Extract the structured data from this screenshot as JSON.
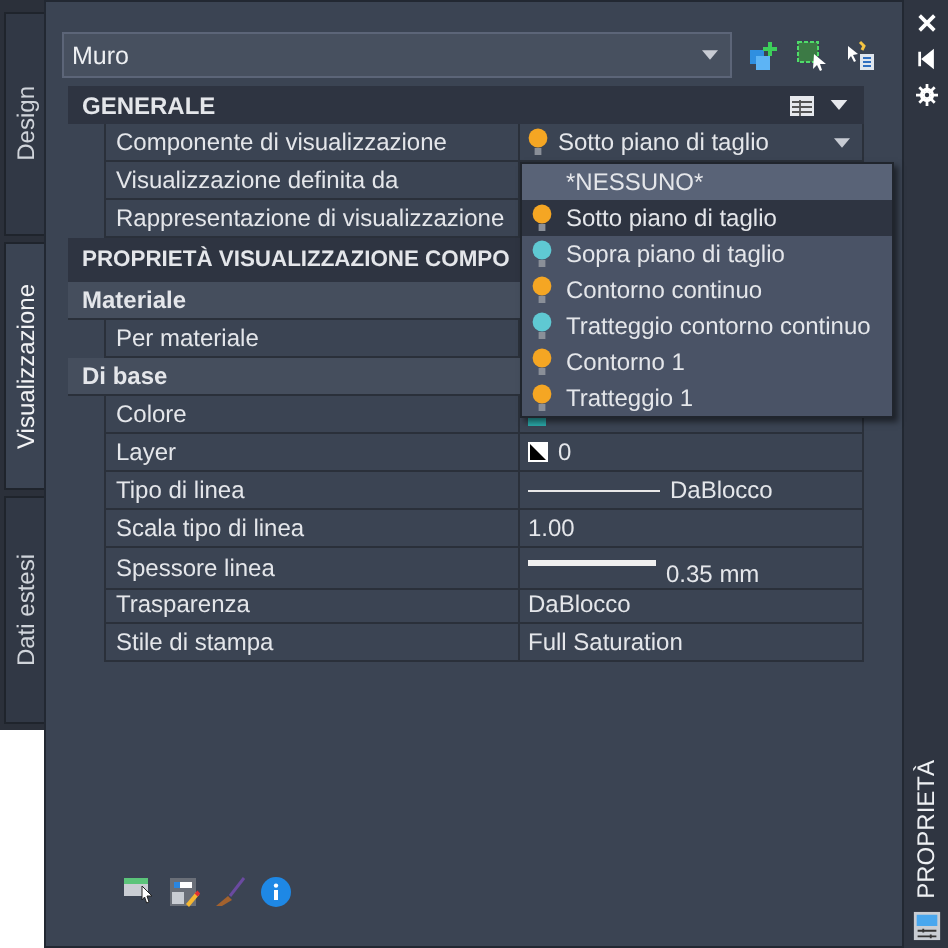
{
  "tabs": [
    {
      "label": "Design",
      "selected": false
    },
    {
      "label": "Visualizzazione",
      "selected": true
    },
    {
      "label": "Dati estesi",
      "selected": false
    }
  ],
  "object_selector": {
    "value": "Muro"
  },
  "grid": [
    {
      "kind": "section",
      "label": "GENERALE",
      "tools": true
    },
    {
      "kind": "bulb",
      "label": "Componente di visualizzazione",
      "value": "Sotto piano di taglio",
      "color": "#f5a623",
      "dropdown": true
    },
    {
      "kind": "property",
      "label": "Visualizzazione definita da"
    },
    {
      "kind": "property",
      "label": "Rappresentazione di visualizzazione"
    },
    {
      "kind": "section",
      "label": "PROPRIETÀ VISUALIZZAZIONE COMPO"
    },
    {
      "kind": "category",
      "label": "Materiale"
    },
    {
      "kind": "property",
      "label": "Per materiale"
    },
    {
      "kind": "category",
      "label": "Di base"
    },
    {
      "kind": "swatch",
      "label": "Colore",
      "color": "#2aa9a9"
    },
    {
      "kind": "layer",
      "label": "Layer",
      "value": "0"
    },
    {
      "kind": "line",
      "label": "Tipo di linea",
      "value": "DaBlocco"
    },
    {
      "kind": "property",
      "label": "Scala tipo di linea",
      "value": "1.00"
    },
    {
      "kind": "lineweight",
      "label": "Spessore linea",
      "value": "0.35 mm"
    },
    {
      "kind": "property",
      "label": "Trasparenza",
      "value": "DaBlocco"
    },
    {
      "kind": "property",
      "label": "Stile di stampa",
      "value": "Full Saturation"
    }
  ],
  "dropdown_list": [
    {
      "label": "*NESSUNO*",
      "selected": false,
      "hovered": true
    },
    {
      "label": "Sotto piano di taglio",
      "color": "#f5a623",
      "selected": true,
      "hovered": false
    },
    {
      "label": "Sopra piano di taglio",
      "color": "#5fc9d3",
      "selected": false,
      "hovered": false
    },
    {
      "label": "Contorno continuo",
      "color": "#f5a623",
      "selected": false,
      "hovered": false
    },
    {
      "label": "Tratteggio contorno continuo",
      "color": "#5fc9d3",
      "selected": false,
      "hovered": false
    },
    {
      "label": "Contorno 1",
      "color": "#f5a623",
      "selected": false,
      "hovered": false
    },
    {
      "label": "Tratteggio 1",
      "color": "#f5a623",
      "selected": false,
      "hovered": false
    }
  ],
  "palette_title": "PROPRIETÀ"
}
